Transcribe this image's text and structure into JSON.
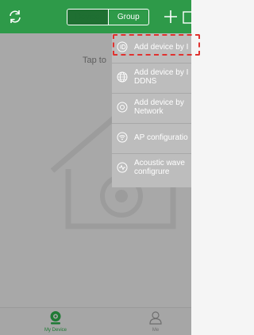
{
  "header": {
    "segments": {
      "device": "Device",
      "group": "Group"
    }
  },
  "main": {
    "prompt": "Tap to"
  },
  "add_menu": {
    "items": [
      {
        "icon": "id-icon",
        "lines": [
          "Add device by I"
        ]
      },
      {
        "icon": "globe-icon",
        "lines": [
          "Add device by I",
          "DDNS"
        ]
      },
      {
        "icon": "network-icon",
        "lines": [
          "Add device by",
          "Network"
        ]
      },
      {
        "icon": "wifi-icon",
        "lines": [
          "AP configuratio"
        ]
      },
      {
        "icon": "sound-wave-icon",
        "lines": [
          "Acoustic wave",
          "configrure"
        ]
      }
    ]
  },
  "tabbar": {
    "tabs": [
      {
        "label": "My Device",
        "icon": "camera-icon",
        "active": true
      },
      {
        "label": "Me",
        "icon": "person-icon",
        "active": false
      }
    ]
  },
  "colors": {
    "header_bg": "#2e9a49",
    "active_tab": "#1f7a35",
    "highlight_border": "#e0322f"
  }
}
